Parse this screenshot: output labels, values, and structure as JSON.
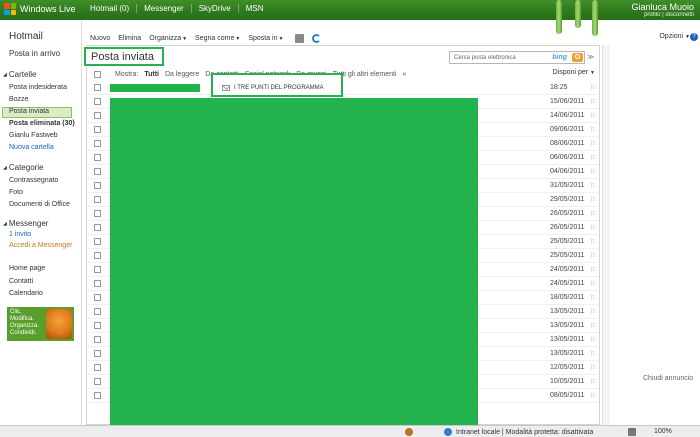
{
  "topbar": {
    "brand": "Windows Live",
    "nav": [
      "Hotmail (0)",
      "Messenger",
      "SkyDrive",
      "MSN"
    ],
    "user_name": "Gianluca Muoio",
    "user_links": "profilo | disconnetti"
  },
  "sidebar": {
    "title": "Hotmail",
    "inbox": "Posta in arrivo",
    "folders_header": "Cartelle",
    "folders": [
      "Posta indesiderata",
      "Bozze",
      "Posta inviata",
      "Posta eliminata (30)",
      "Gianlu Fastweb"
    ],
    "new_folder": "Nuova cartella",
    "categories_header": "Categorie",
    "categories": [
      "Contrassegnato",
      "Foto",
      "Documenti di Office"
    ],
    "messenger_header": "Messenger",
    "messenger_invite": "1 invito",
    "messenger_access": "Accedi a Messenger",
    "links": [
      "Home page",
      "Contatti",
      "Calendario"
    ],
    "promo": [
      "Clic.",
      "Modifica.",
      "Organizza.",
      "Condividi."
    ]
  },
  "toolbar": {
    "new": "Nuovo",
    "delete": "Elimina",
    "organize": "Organizza",
    "mark": "Segna come",
    "move": "Sposta in",
    "options": "Opzioni"
  },
  "main": {
    "folder_title": "Posta inviata",
    "search_placeholder": "Cerca posta elettronica",
    "search_brand": "bing",
    "filter_label": "Mostra:",
    "filters": [
      "Tutti",
      "Da leggere",
      "Da contatti",
      "Social network",
      "Da gruppi",
      "Tutti gli altri elementi"
    ],
    "sort": "Disponi per",
    "highlight_subject": "I TRE PUNTI DEL PROGRAMMA",
    "dates": [
      "18:25",
      "15/06/2011",
      "14/06/2011",
      "09/06/2011",
      "08/06/2011",
      "06/06/2011",
      "04/06/2011",
      "31/05/2011",
      "29/05/2011",
      "26/05/2011",
      "26/05/2011",
      "25/05/2011",
      "25/05/2011",
      "24/05/2011",
      "24/05/2011",
      "18/05/2011",
      "13/05/2011",
      "13/05/2011",
      "13/05/2011",
      "13/05/2011",
      "12/05/2011",
      "10/05/2011",
      "08/05/2011"
    ]
  },
  "close_ad": "Chiudi annuncio",
  "statusbar": {
    "zone": "Intranet locale | Modalità protetta: disattivata",
    "zoom": "100%"
  },
  "colors": {
    "brand_green": "#2f7a1d",
    "highlight_green": "#25b14d",
    "redaction_green": "#22b34f",
    "selected_bg": "#d9ecc4"
  }
}
